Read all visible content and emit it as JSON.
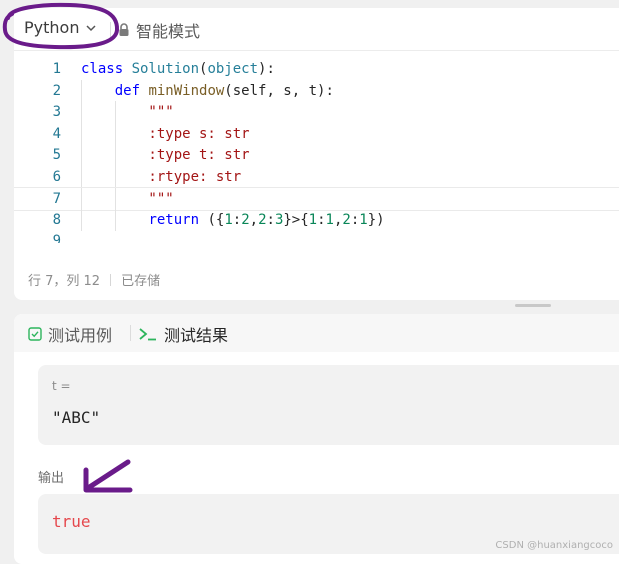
{
  "editor": {
    "language": "Python",
    "mode_label": "智能模式",
    "lines": [
      {
        "n": "1",
        "tokens": [
          {
            "t": "class ",
            "c": "kw"
          },
          {
            "t": "Solution",
            "c": "cls"
          },
          {
            "t": "(",
            "c": "plain"
          },
          {
            "t": "object",
            "c": "cls"
          },
          {
            "t": "):",
            "c": "plain"
          }
        ]
      },
      {
        "n": "2",
        "tokens": [
          {
            "t": "    ",
            "c": "plain"
          },
          {
            "t": "def ",
            "c": "kw"
          },
          {
            "t": "minWindow",
            "c": "fn"
          },
          {
            "t": "(self, s, t):",
            "c": "plain"
          }
        ]
      },
      {
        "n": "3",
        "tokens": [
          {
            "t": "        \"\"\"",
            "c": "str"
          }
        ]
      },
      {
        "n": "4",
        "tokens": [
          {
            "t": "        :type s: str",
            "c": "str"
          }
        ]
      },
      {
        "n": "5",
        "tokens": [
          {
            "t": "        :type t: str",
            "c": "str"
          }
        ]
      },
      {
        "n": "6",
        "tokens": [
          {
            "t": "        :rtype: str",
            "c": "str"
          }
        ]
      },
      {
        "n": "7",
        "tokens": [
          {
            "t": "        \"\"\"",
            "c": "str"
          }
        ]
      },
      {
        "n": "8",
        "tokens": [
          {
            "t": "        ",
            "c": "plain"
          },
          {
            "t": "return ",
            "c": "kw"
          },
          {
            "t": "({",
            "c": "plain"
          },
          {
            "t": "1",
            "c": "num"
          },
          {
            "t": ":",
            "c": "plain"
          },
          {
            "t": "2",
            "c": "num"
          },
          {
            "t": ",",
            "c": "plain"
          },
          {
            "t": "2",
            "c": "num"
          },
          {
            "t": ":",
            "c": "plain"
          },
          {
            "t": "3",
            "c": "num"
          },
          {
            "t": "}>{",
            "c": "plain"
          },
          {
            "t": "1",
            "c": "num"
          },
          {
            "t": ":",
            "c": "plain"
          },
          {
            "t": "1",
            "c": "num"
          },
          {
            "t": ",",
            "c": "plain"
          },
          {
            "t": "2",
            "c": "num"
          },
          {
            "t": ":",
            "c": "plain"
          },
          {
            "t": "1",
            "c": "num"
          },
          {
            "t": "})",
            "c": "plain"
          }
        ]
      },
      {
        "n": "9",
        "tokens": []
      }
    ],
    "status_position": "行 7，列 12",
    "status_saved": "已存储"
  },
  "result_panel": {
    "tab_testcase": "测试用例",
    "tab_result": "测试结果",
    "input_label": "t =",
    "input_value": "\"ABC\"",
    "output_label": "输出",
    "output_value": "true"
  },
  "watermark": "CSDN @huanxiangcoco",
  "colors": {
    "annotation": "#6a1b8a",
    "output_error": "#e5484d",
    "accent_green": "#2db55d"
  },
  "icons": {
    "lock": "lock-icon",
    "chevron": "chevron-down-icon",
    "checkbox": "checkbox-icon",
    "terminal": "terminal-icon"
  }
}
